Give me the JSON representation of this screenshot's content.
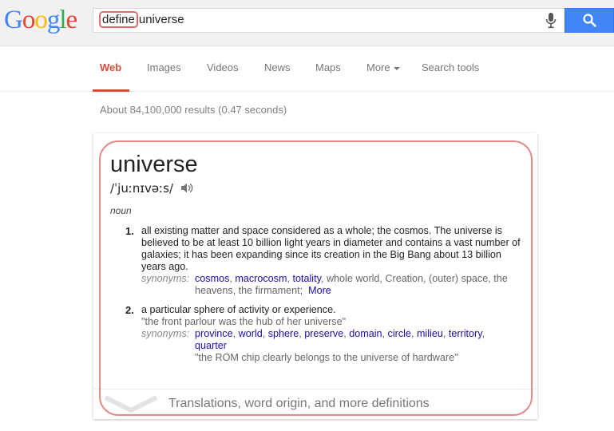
{
  "logo": {
    "letters": [
      "G",
      "o",
      "o",
      "g",
      "l",
      "e"
    ],
    "colors": [
      "#4285f4",
      "#ea4335",
      "#fbbc05",
      "#4285f4",
      "#34a853",
      "#ea4335"
    ]
  },
  "search": {
    "highlighted": "define",
    "rest": "universe",
    "mic_icon": "mic-icon",
    "button_icon": "magnifier-icon"
  },
  "nav": {
    "tabs": [
      "Web",
      "Images",
      "Videos",
      "News",
      "Maps",
      "More",
      "Search tools"
    ],
    "active": "Web"
  },
  "result_stats": "About 84,100,000 results (0.47 seconds)",
  "definition": {
    "word": "universe",
    "phonetic": "/ˈjuːnɪvəːs/",
    "part_of_speech": "noun",
    "senses": [
      {
        "number": "1.",
        "text": "all existing matter and space considered as a whole; the cosmos. The universe is believed to be at least 10 billion light years in diameter and contains a vast number of galaxies; it has been expanding since its creation in the Big Bang about 13 billion years ago.",
        "synonyms_label": "synonyms:",
        "synonyms_links": [
          "cosmos",
          "macrocosm",
          "totality"
        ],
        "synonyms_plain": "whole world, Creation, (outer) space, the heavens, the firmament;",
        "more_label": "More"
      },
      {
        "number": "2.",
        "text": "a particular sphere of activity or experience.",
        "example": "\"the front parlour was the hub of her universe\"",
        "synonyms_label": "synonyms:",
        "synonyms_links": [
          "province",
          "world",
          "sphere",
          "preserve",
          "domain",
          "circle",
          "milieu",
          "territory",
          "quarter"
        ],
        "synonym_example": "\"the ROM chip clearly belongs to the universe of hardware\""
      }
    ],
    "more_definitions": "Translations, word origin, and more definitions"
  }
}
